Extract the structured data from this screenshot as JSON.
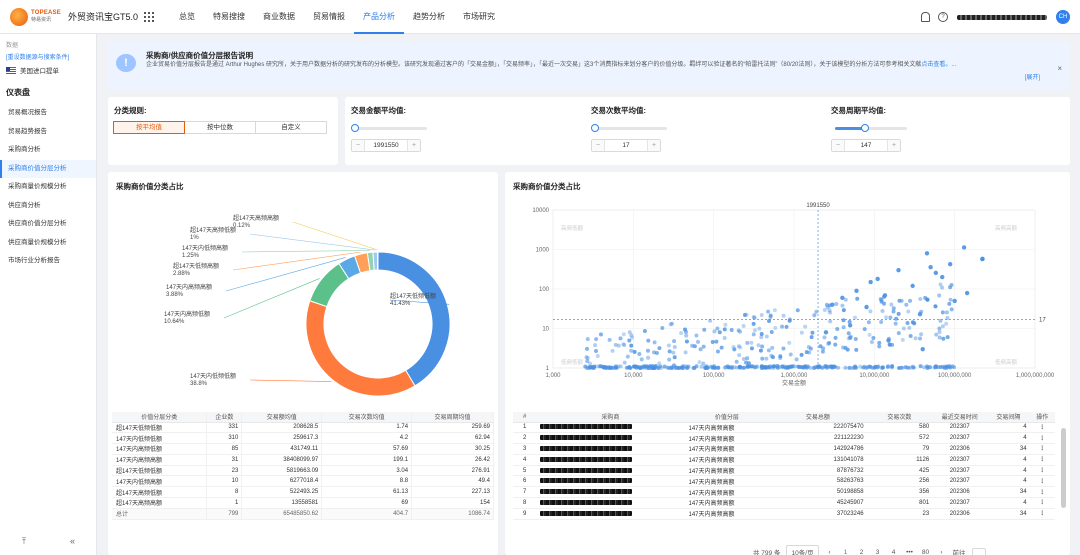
{
  "app": {
    "logo_en": "TOPEASE",
    "logo_cn": "特易资讯",
    "title": "外贸资讯宝GT5.0",
    "user_avatar": "CH",
    "accent": "#2f80ed"
  },
  "nav": {
    "items": [
      {
        "label": "总览",
        "active": false
      },
      {
        "label": "特易搜搜",
        "active": false
      },
      {
        "label": "商业数据",
        "active": false
      },
      {
        "label": "贸易情报",
        "active": false
      },
      {
        "label": "产品分析",
        "active": true
      },
      {
        "label": "趋势分析",
        "active": false
      },
      {
        "label": "市场研究",
        "active": false
      }
    ]
  },
  "sidebar": {
    "data_label": "数据",
    "data_link": "[重设数据源与搜索条件]",
    "market": "美国进口提单",
    "section_title": "仪表盘",
    "items": [
      {
        "label": "贸易概况报告",
        "active": false
      },
      {
        "label": "贸易趋势报告",
        "active": false
      },
      {
        "label": "采购商分析",
        "active": false
      },
      {
        "label": "采购商价值分层分析",
        "active": true
      },
      {
        "label": "采购商量价规模分析",
        "active": false
      },
      {
        "label": "供应商分析",
        "active": false
      },
      {
        "label": "供应商价值分层分析",
        "active": false
      },
      {
        "label": "供应商量价规模分析",
        "active": false
      },
      {
        "label": "市场行业分析报告",
        "active": false
      }
    ],
    "bottom_left": "⤒",
    "bottom_right": "«"
  },
  "notice": {
    "title": "采购商/供应商价值分层报告说明",
    "text": "企业贸易价值分层报告是通过 Arthur Hughes 研究所，关于用户数据分析的研究发布的分析模型。该研究发现通过客户的「交易金额」，「交易频率」，「最近一次交易」这3个消费指标来划分客户的价值分级。羁绊可以验证著名的“帕雷托法则”（80/20法则），关于该模型的分析方法可参考相关文献",
    "link": "点击查看。...",
    "expand": "[展开]",
    "close": "×"
  },
  "filters": {
    "rule_label": "分类规则:",
    "rule_options": [
      {
        "label": "按平均值",
        "active": true
      },
      {
        "label": "按中位数",
        "active": false
      },
      {
        "label": "自定义",
        "active": false
      }
    ],
    "sliders": [
      {
        "label": "交易金额平均值:",
        "value": "1991550",
        "fill": 0.0
      },
      {
        "label": "交易次数平均值:",
        "value": "17",
        "fill": 0.0
      },
      {
        "label": "交易周期平均值:",
        "value": "147",
        "fill": 0.42
      }
    ],
    "minus": "−",
    "plus": "+"
  },
  "left_panel": {
    "title": "采购商价值分类占比",
    "table": {
      "headers": [
        "价值分层分类",
        "企业数",
        "交易额均值",
        "交易次数均值",
        "交易周期均值"
      ],
      "rows": [
        [
          "超147天低频低额",
          "331",
          "208628.5",
          "1.74",
          "259.69"
        ],
        [
          "147天内低频低额",
          "310",
          "259617.3",
          "4.2",
          "62.94"
        ],
        [
          "147天内高频低额",
          "85",
          "431749.11",
          "57.69",
          "30.25"
        ],
        [
          "147天内高频高额",
          "31",
          "38408099.97",
          "199.1",
          "26.42"
        ],
        [
          "超147天低频低额",
          "23",
          "5819663.09",
          "3.04",
          "276.91"
        ],
        [
          "147天内低频高额",
          "10",
          "6277018.4",
          "8.8",
          "49.4"
        ],
        [
          "超147天高频低额",
          "8",
          "522493.25",
          "61.13",
          "227.13"
        ],
        [
          "超147天高频高额",
          "1",
          "13558581",
          "69",
          "154"
        ]
      ],
      "total": [
        "总计",
        "799",
        "65485850.62",
        "404.7",
        "1086.74"
      ]
    }
  },
  "right_panel": {
    "title": "采购商价值分类占比",
    "table": {
      "headers": [
        "#",
        "采购商",
        "价值分层",
        "交易总额",
        "交易次数",
        "最近交易时间",
        "交易间隔",
        "操作"
      ],
      "rows": [
        [
          "1",
          "147天内高频高额",
          "222075470",
          "580",
          "202307",
          "4"
        ],
        [
          "2",
          "147天内高频高额",
          "221122230",
          "572",
          "202307",
          "4"
        ],
        [
          "3",
          "147天内高频高额",
          "142924786",
          "79",
          "202306",
          "34"
        ],
        [
          "4",
          "147天内高频高额",
          "131041078",
          "1126",
          "202307",
          "4"
        ],
        [
          "5",
          "147天内高频高额",
          "87876732",
          "425",
          "202307",
          "4"
        ],
        [
          "6",
          "147天内高频高额",
          "58263763",
          "256",
          "202307",
          "4"
        ],
        [
          "7",
          "147天内高频高额",
          "50198858",
          "356",
          "202306",
          "34"
        ],
        [
          "8",
          "147天内高频高额",
          "45245907",
          "801",
          "202307",
          "4"
        ],
        [
          "9",
          "147天内高频高额",
          "37023246",
          "23",
          "202306",
          "34"
        ]
      ],
      "ops_symbol": "⋮"
    },
    "pager": {
      "total": "共 799 条",
      "page_size": "10条/页",
      "prev": "‹",
      "pages": [
        "1",
        "2",
        "3",
        "4",
        "•••",
        "80"
      ],
      "next": "›",
      "goto": "前往"
    }
  },
  "chart_data": [
    {
      "type": "pie",
      "title": "采购商价值分类占比",
      "donut": true,
      "slices": [
        {
          "name": "超147天低频低额",
          "value": 41.43,
          "label": "41.43%",
          "color": "#4a90e2"
        },
        {
          "name": "147天内低频低额",
          "value": 38.8,
          "label": "38.8%",
          "color": "#ff7a3d"
        },
        {
          "name": "147天内高频低额",
          "value": 10.64,
          "label": "10.64%",
          "color": "#5cc08a"
        },
        {
          "name": "147天内高频高额",
          "value": 3.88,
          "label": "3.88%",
          "color": "#5aa9e6"
        },
        {
          "name": "超147天低频高额",
          "value": 2.88,
          "label": "2.88%",
          "color": "#ff9f5a"
        },
        {
          "name": "147天内低频高额",
          "value": 1.25,
          "label": "1.25%",
          "color": "#94d3b0"
        },
        {
          "name": "超147天高频低额",
          "value": 1.0,
          "label": "1%",
          "color": "#a0c8f0"
        },
        {
          "name": "超147天高频高额",
          "value": 0.12,
          "label": "0.12%",
          "color": "#f2c94c"
        }
      ]
    },
    {
      "type": "scatter",
      "title": "采购商价值分类占比",
      "xlabel": "交易金额",
      "ylabel": "",
      "x_scale": "log",
      "y_scale": "log",
      "xlim": [
        1000,
        1000000000
      ],
      "ylim": [
        1,
        10000
      ],
      "x_ticks": [
        "1,000",
        "10,000",
        "100,000",
        "1,000,000",
        "10,000,000",
        "100,000,000",
        "1,000,000,000"
      ],
      "y_ticks": [
        "1",
        "10",
        "100",
        "1000",
        "10000"
      ],
      "ref_x": 1991550,
      "ref_x_label": "1991550",
      "ref_y": 17,
      "ref_y_label": "17",
      "quadrant_labels": [
        "高频低额",
        "高频高额",
        "低频低额",
        "低频高额"
      ],
      "point_color": "#4a90e2",
      "points": [
        [
          222075470,
          580
        ],
        [
          221122230,
          572
        ],
        [
          142924786,
          79
        ],
        [
          131041078,
          1126
        ],
        [
          87876732,
          425
        ],
        [
          58263763,
          256
        ],
        [
          50198858,
          356
        ],
        [
          45245907,
          801
        ],
        [
          37023246,
          23
        ],
        [
          13558581,
          69
        ],
        [
          9000000,
          150
        ],
        [
          6000000,
          90
        ],
        [
          4000000,
          60
        ],
        [
          3000000,
          40
        ],
        [
          20000000,
          300
        ],
        [
          70000000,
          200
        ],
        [
          30000000,
          120
        ],
        [
          8000000,
          35
        ],
        [
          5000000,
          12
        ],
        [
          2500000,
          8
        ],
        [
          15000000,
          5
        ],
        [
          40000000,
          3
        ],
        [
          100000000,
          50
        ],
        [
          11000000,
          180
        ]
      ]
    }
  ]
}
